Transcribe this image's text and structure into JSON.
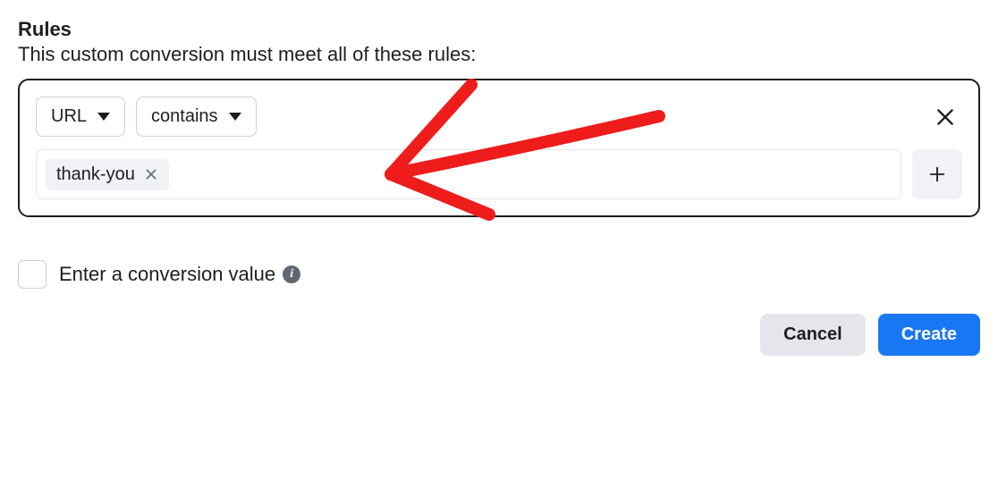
{
  "section": {
    "title": "Rules",
    "subtitle": "This custom conversion must meet all of these rules:"
  },
  "rule": {
    "field_label": "URL",
    "operator_label": "contains",
    "chip_value": "thank-you"
  },
  "conversion": {
    "checkbox_label": "Enter a conversion value"
  },
  "buttons": {
    "cancel": "Cancel",
    "create": "Create"
  },
  "colors": {
    "primary": "#1877f2",
    "annotation": "#ef1c1c"
  }
}
